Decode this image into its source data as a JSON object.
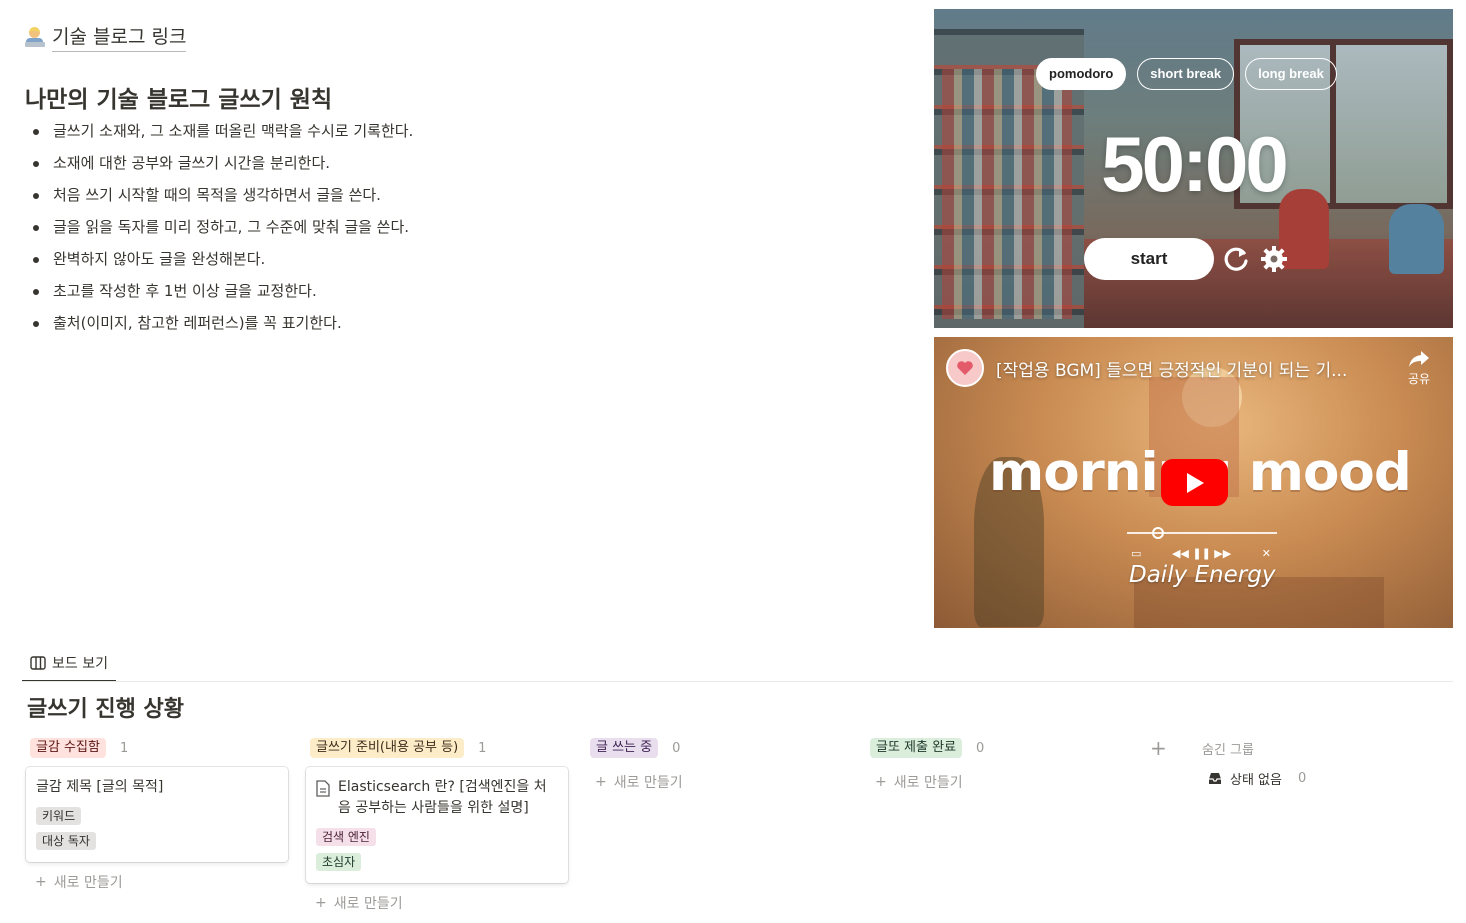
{
  "header": {
    "link_text": "기술 블로그 링크",
    "link_icon": "person-at-laptop-emoji"
  },
  "principles": {
    "title": "나만의 기술 블로그 글쓰기 원칙",
    "items": [
      "글쓰기 소재와, 그 소재를 떠올린 맥락을 수시로 기록한다.",
      "소재에 대한 공부와 글쓰기 시간을 분리한다.",
      "처음 쓰기 시작할 때의 목적을 생각하면서 글을 쓴다.",
      "글을 읽을 독자를 미리 정하고, 그 수준에 맞춰 글을 쓴다.",
      "완벽하지 않아도 글을 완성해본다.",
      "초고를 작성한 후 1번 이상 글을 교정한다.",
      "출처(이미지, 참고한 레퍼런스)를 꼭 표기한다."
    ]
  },
  "pomodoro": {
    "tabs": [
      "pomodoro",
      "short break",
      "long break"
    ],
    "active_tab": "pomodoro",
    "time": "50:00",
    "start_label": "start",
    "icons": [
      "reset-icon",
      "settings-gear-icon"
    ]
  },
  "youtube": {
    "title": "[작업용 BGM] 들으면 긍정적인 기분이 되는 기...",
    "share_label": "공유",
    "headline": "morning mood",
    "caption": "Daily Energy",
    "play_color": "#ff0000"
  },
  "board": {
    "view_tab": "보드 보기",
    "title": "글쓰기 진행 상황",
    "new_label": "새로 만들기",
    "columns": [
      {
        "name": "글감 수집함",
        "count": "1",
        "color": "#ffe2dd",
        "cards": [
          {
            "title": "글감 제목 [글의 목적]",
            "tags": [
              "키워드",
              "대상 독자"
            ]
          }
        ]
      },
      {
        "name": "글쓰기 준비(내용 공부 등)",
        "count": "1",
        "color": "#fdecc8",
        "cards": [
          {
            "title": "Elasticsearch 란? [검색엔진을 처음 공부하는 사람들을 위한 설명]",
            "tags": [
              "검색 엔진",
              "초심자"
            ]
          }
        ]
      },
      {
        "name": "글 쓰는 중",
        "count": "0",
        "color": "#e8deee",
        "cards": []
      },
      {
        "name": "글또 제출 완료",
        "count": "0",
        "color": "#dbeddb",
        "cards": []
      }
    ],
    "hidden_groups_label": "숨긴 그룹",
    "hidden_groups": [
      {
        "name": "상태 없음",
        "count": "0"
      }
    ]
  }
}
